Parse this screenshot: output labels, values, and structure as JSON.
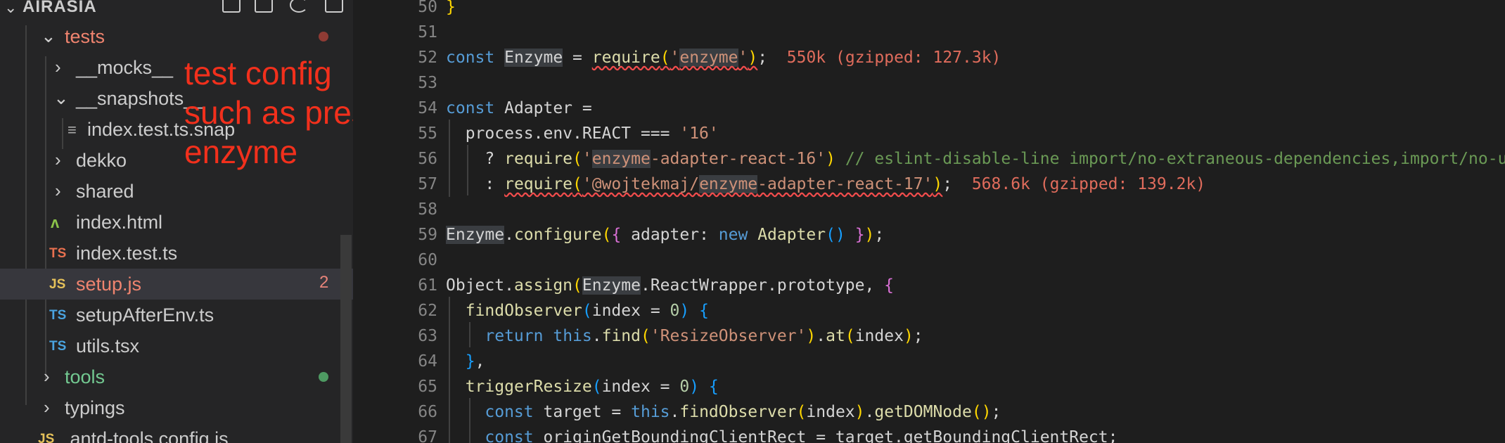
{
  "sidebar": {
    "section_title": "AIRASIA",
    "tree": [
      {
        "label": "tests",
        "type": "folder-open",
        "color": "#f0846f",
        "status": "modified-dot"
      },
      {
        "label": "__mocks__",
        "type": "folder"
      },
      {
        "label": "__snapshots__",
        "type": "folder-open"
      },
      {
        "label": "index.test.ts.snap",
        "type": "file-snap"
      },
      {
        "label": "dekko",
        "type": "folder"
      },
      {
        "label": "shared",
        "type": "folder"
      },
      {
        "label": "index.html",
        "type": "file-html",
        "icon": "ʌ"
      },
      {
        "label": "index.test.ts",
        "type": "file-ts",
        "icon": "TS"
      },
      {
        "label": "setup.js",
        "type": "file-js",
        "icon": "JS",
        "color": "#f0846f",
        "badge": "2",
        "selected": true
      },
      {
        "label": "setupAfterEnv.ts",
        "type": "file-ts",
        "icon": "TS"
      },
      {
        "label": "utils.tsx",
        "type": "file-ts",
        "icon": "TS"
      },
      {
        "label": "tools",
        "type": "folder",
        "color": "#73c991",
        "status": "added-dot"
      },
      {
        "label": "typings",
        "type": "folder"
      },
      {
        "label": ".antd-tools.config.js",
        "type": "file-js",
        "icon": "JS"
      }
    ],
    "annotation": [
      "test config",
      "such as preset",
      "enzyme"
    ]
  },
  "editor": {
    "line_numbers": [
      "50",
      "51",
      "52",
      "53",
      "54",
      "55",
      "56",
      "57",
      "58",
      "59",
      "60",
      "61",
      "62",
      "63",
      "64",
      "65",
      "66",
      "67"
    ],
    "size_hints": {
      "line52": "550k (gzipped: 127.3k)",
      "line57": "568.6k (gzipped: 139.2k)"
    }
  },
  "colors": {
    "editor_bg": "#1e1e1e",
    "sidebar_bg": "#252526",
    "annotation": "#f2301c",
    "keyword": "#569cd6",
    "string": "#ce9178",
    "comment": "#6a9955"
  }
}
